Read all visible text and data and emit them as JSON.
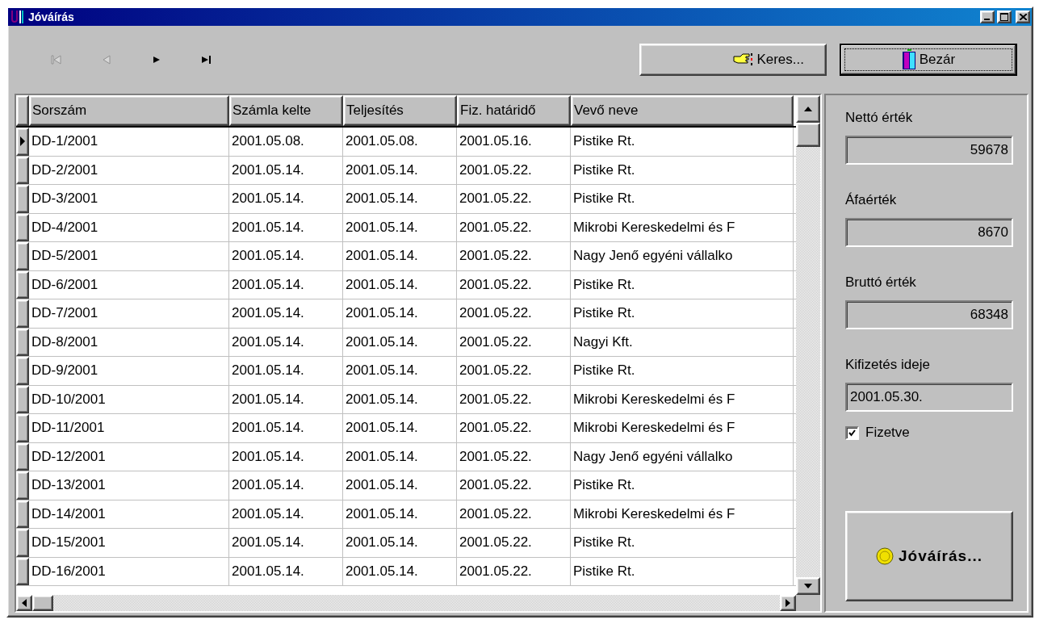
{
  "window": {
    "title": "Jóváírás"
  },
  "navigator": [
    {
      "kind": "first",
      "disabled": true
    },
    {
      "kind": "prev",
      "disabled": true
    },
    {
      "kind": "next",
      "disabled": false
    },
    {
      "kind": "last",
      "disabled": false
    }
  ],
  "toolbar_buttons": [
    {
      "kind": "search",
      "label": "Keres...",
      "focused": false
    },
    {
      "kind": "close",
      "label": "Bezár",
      "focused": true
    }
  ],
  "table": {
    "columns": [
      "Sorszám",
      "Számla kelte",
      "Teljesítés",
      "Fiz. határidő",
      "Vevő neve"
    ],
    "rows": [
      {
        "current": true,
        "cells": [
          "DD-1/2001",
          "2001.05.08.",
          "2001.05.08.",
          "2001.05.16.",
          "Pistike Rt."
        ]
      },
      {
        "current": false,
        "cells": [
          "DD-2/2001",
          "2001.05.14.",
          "2001.05.14.",
          "2001.05.22.",
          "Pistike Rt."
        ]
      },
      {
        "current": false,
        "cells": [
          "DD-3/2001",
          "2001.05.14.",
          "2001.05.14.",
          "2001.05.22.",
          "Pistike Rt."
        ]
      },
      {
        "current": false,
        "cells": [
          "DD-4/2001",
          "2001.05.14.",
          "2001.05.14.",
          "2001.05.22.",
          "Mikrobi Kereskedelmi és F"
        ]
      },
      {
        "current": false,
        "cells": [
          "DD-5/2001",
          "2001.05.14.",
          "2001.05.14.",
          "2001.05.22.",
          "Nagy Jenő egyéni vállalko"
        ]
      },
      {
        "current": false,
        "cells": [
          "DD-6/2001",
          "2001.05.14.",
          "2001.05.14.",
          "2001.05.22.",
          "Pistike Rt."
        ]
      },
      {
        "current": false,
        "cells": [
          "DD-7/2001",
          "2001.05.14.",
          "2001.05.14.",
          "2001.05.22.",
          "Pistike Rt."
        ]
      },
      {
        "current": false,
        "cells": [
          "DD-8/2001",
          "2001.05.14.",
          "2001.05.14.",
          "2001.05.22.",
          "Nagyi Kft."
        ]
      },
      {
        "current": false,
        "cells": [
          "DD-9/2001",
          "2001.05.14.",
          "2001.05.14.",
          "2001.05.22.",
          "Pistike Rt."
        ]
      },
      {
        "current": false,
        "cells": [
          "DD-10/2001",
          "2001.05.14.",
          "2001.05.14.",
          "2001.05.22.",
          "Mikrobi Kereskedelmi és F"
        ]
      },
      {
        "current": false,
        "cells": [
          "DD-11/2001",
          "2001.05.14.",
          "2001.05.14.",
          "2001.05.22.",
          "Mikrobi Kereskedelmi és F"
        ]
      },
      {
        "current": false,
        "cells": [
          "DD-12/2001",
          "2001.05.14.",
          "2001.05.14.",
          "2001.05.22.",
          "Nagy Jenő egyéni vállalko"
        ]
      },
      {
        "current": false,
        "cells": [
          "DD-13/2001",
          "2001.05.14.",
          "2001.05.14.",
          "2001.05.22.",
          "Pistike Rt."
        ]
      },
      {
        "current": false,
        "cells": [
          "DD-14/2001",
          "2001.05.14.",
          "2001.05.14.",
          "2001.05.22.",
          "Mikrobi Kereskedelmi és F"
        ]
      },
      {
        "current": false,
        "cells": [
          "DD-15/2001",
          "2001.05.14.",
          "2001.05.14.",
          "2001.05.22.",
          "Pistike Rt."
        ]
      },
      {
        "current": false,
        "cells": [
          "DD-16/2001",
          "2001.05.14.",
          "2001.05.14.",
          "2001.05.22.",
          "Pistike Rt."
        ]
      }
    ]
  },
  "side_panel": {
    "fields": [
      {
        "label": "Nettó érték",
        "value": "59678",
        "kind": "amount"
      },
      {
        "label": "Áfaérték",
        "value": "8670",
        "kind": "amount"
      },
      {
        "label": "Bruttó érték",
        "value": "68348",
        "kind": "amount"
      },
      {
        "label": "Kifizetés ideje",
        "value": "2001.05.30.",
        "kind": "date"
      }
    ],
    "checkbox": {
      "label": "Fizetve",
      "checked": true
    },
    "action_button": {
      "label": "Jóváírás..."
    }
  }
}
